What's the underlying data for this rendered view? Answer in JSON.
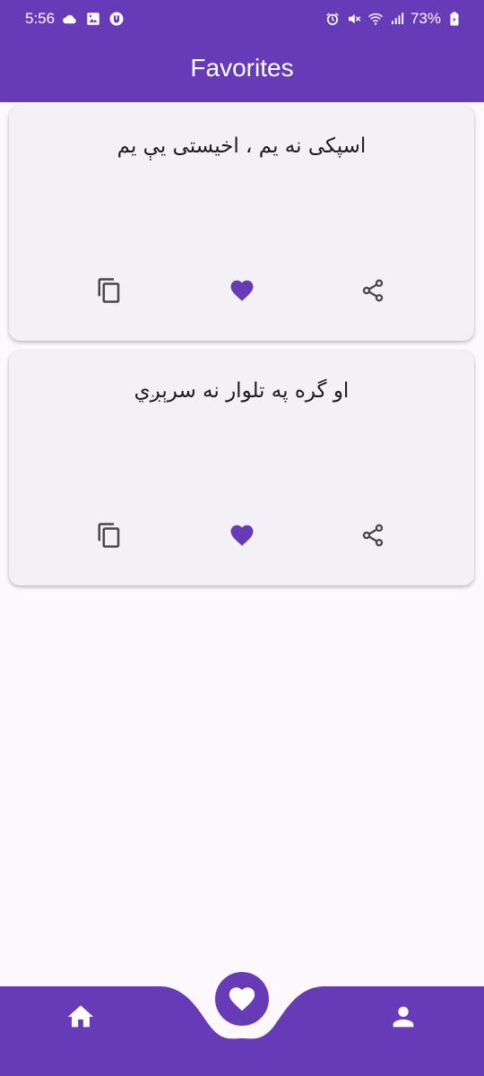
{
  "status_bar": {
    "time": "5:56",
    "battery": "73%"
  },
  "app_bar": {
    "title": "Favorites"
  },
  "favorites": [
    {
      "text": "اسپکی نه یم ، اخیستی يې یم",
      "actions": [
        "copy-icon",
        "favorite-heart-icon",
        "share-icon"
      ]
    },
    {
      "text": "او گره په تلوار نه سرېږي",
      "actions": [
        "copy-icon",
        "favorite-heart-icon",
        "share-icon"
      ]
    }
  ],
  "bottom_nav": {
    "items": [
      "home-icon",
      "favorites-heart-icon",
      "profile-icon"
    ],
    "selected": "favorites"
  },
  "colors": {
    "primary": "#673ab7",
    "background": "#fdf7fe",
    "card": "#f4f1f6",
    "icon": "#49454f",
    "text": "#1d1b20"
  }
}
